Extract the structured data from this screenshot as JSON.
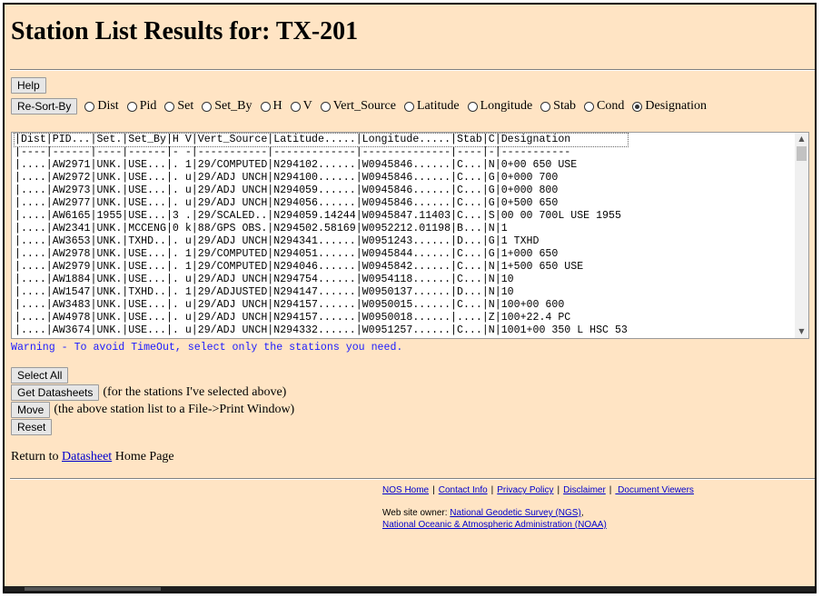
{
  "page": {
    "title": "Station List Results for: TX-201"
  },
  "buttons": {
    "help": "Help",
    "resort": "Re-Sort-By",
    "select_all": "Select All",
    "get_datasheets": "Get Datasheets",
    "move": "Move",
    "reset": "Reset"
  },
  "sort_options": [
    {
      "label": "Dist",
      "selected": false
    },
    {
      "label": "Pid",
      "selected": false
    },
    {
      "label": "Set",
      "selected": false
    },
    {
      "label": "Set_By",
      "selected": false
    },
    {
      "label": "H",
      "selected": false
    },
    {
      "label": "V",
      "selected": false
    },
    {
      "label": "Vert_Source",
      "selected": false
    },
    {
      "label": "Latitude",
      "selected": false
    },
    {
      "label": "Longitude",
      "selected": false
    },
    {
      "label": "Stab",
      "selected": false
    },
    {
      "label": "Cond",
      "selected": false
    },
    {
      "label": "Designation",
      "selected": true
    }
  ],
  "station_list": {
    "lines": [
      "|Dist|PID...|Set.|Set_By|H V|Vert_Source|Latitude.....|Longitude.....|Stab|C|Designation",
      "|----|------|----|------|- -|-----------|-------------|--------------|----|-|-----------",
      "|....|AW2971|UNK.|USE...|. 1|29/COMPUTED|N294102......|W0945846......|C...|N|0+00 650 USE",
      "|....|AW2972|UNK.|USE...|. u|29/ADJ UNCH|N294100......|W0945846......|C...|G|0+000 700",
      "|....|AW2973|UNK.|USE...|. u|29/ADJ UNCH|N294059......|W0945846......|C...|G|0+000 800",
      "|....|AW2977|UNK.|USE...|. u|29/ADJ UNCH|N294056......|W0945846......|C...|G|0+500 650",
      "|....|AW6165|1955|USE...|3 .|29/SCALED..|N294059.14244|W0945847.11403|C...|S|00 00 700L USE 1955",
      "|....|AW2341|UNK.|MCCENG|0 k|88/GPS OBS.|N294502.58169|W0952212.01198|B...|N|1",
      "|....|AW3653|UNK.|TXHD..|. u|29/ADJ UNCH|N294341......|W0951243......|D...|G|1 TXHD",
      "|....|AW2978|UNK.|USE...|. 1|29/COMPUTED|N294051......|W0945844......|C...|G|1+000 650",
      "|....|AW2979|UNK.|USE...|. 1|29/COMPUTED|N294046......|W0945842......|C...|N|1+500 650 USE",
      "|....|AW1884|UNK.|USE...|. u|29/ADJ UNCH|N294754......|W0954118......|C...|N|10",
      "|....|AW1547|UNK.|TXHD..|. 1|29/ADJUSTED|N294147......|W0950137......|D...|N|10",
      "|....|AW3483|UNK.|USE...|. u|29/ADJ UNCH|N294157......|W0950015......|C...|N|100+00 600",
      "|....|AW4978|UNK.|USE...|. u|29/ADJ UNCH|N294157......|W0950018......|....|Z|100+22.4 PC",
      "|....|AW3674|UNK.|USE...|. u|29/ADJ UNCH|N294332......|W0951257......|C...|N|1001+00 350 L HSC 53"
    ]
  },
  "warning": "Warning - To avoid TimeOut, select only the stations you need.",
  "actions": {
    "get_datasheets_note": "(for the stations I've selected above)",
    "move_note": "(the above station list to a File->Print Window)"
  },
  "return_line": {
    "prefix": "Return to",
    "link": "Datasheet",
    "suffix": "Home Page"
  },
  "footer": {
    "links": [
      "NOS Home",
      "Contact Info",
      "Privacy Policy",
      "Disclaimer",
      " Document Viewers"
    ],
    "separator": "|",
    "owner_label": "Web site owner:",
    "owner_link1": "National Geodetic Survey (NGS)",
    "owner_link1_suffix": ",",
    "owner_link2": "National Oceanic & Atmospheric Administration (NOAA)"
  }
}
